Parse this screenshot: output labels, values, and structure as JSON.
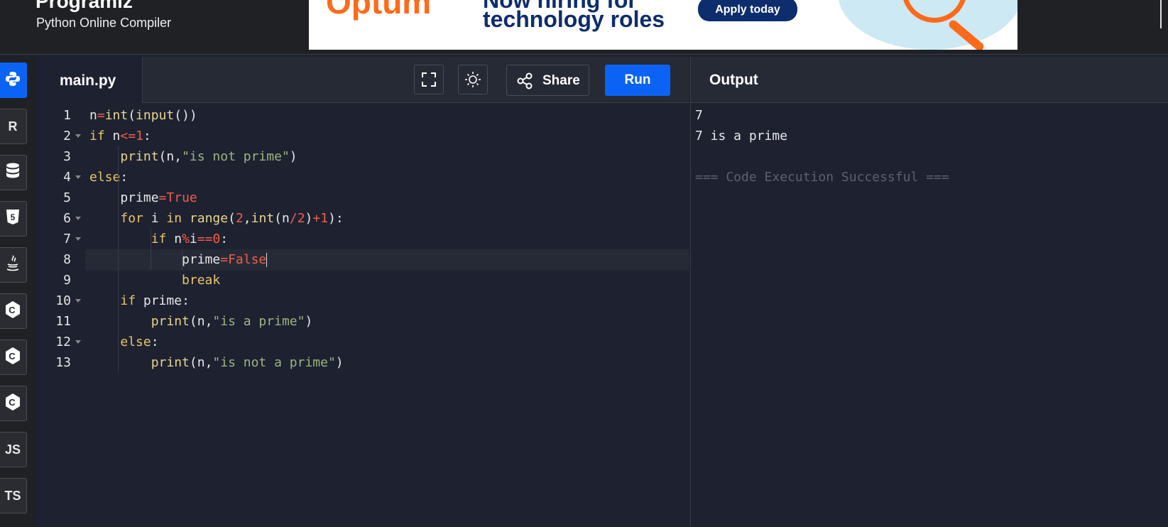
{
  "header": {
    "brand": "Programiz",
    "subtitle": "Python Online Compiler"
  },
  "ad": {
    "brand": "Optum",
    "headline_1": "Now hiring for",
    "headline_2": "technology roles",
    "button": "Apply today"
  },
  "languages": [
    {
      "name": "python-icon",
      "label": "",
      "active": true
    },
    {
      "name": "r-icon",
      "label": "R"
    },
    {
      "name": "sql-icon",
      "label": ""
    },
    {
      "name": "html5-icon",
      "label": "5"
    },
    {
      "name": "java-icon",
      "label": ""
    },
    {
      "name": "c-icon",
      "label": "C"
    },
    {
      "name": "cpp-icon",
      "label": "C"
    },
    {
      "name": "csharp-icon",
      "label": "C"
    },
    {
      "name": "js-icon",
      "label": "JS"
    },
    {
      "name": "ts-icon",
      "label": "TS"
    }
  ],
  "editor": {
    "file_tab": "main.py",
    "share_label": "Share",
    "run_label": "Run",
    "current_line": 8,
    "lines": [
      {
        "n": "1",
        "tokens": [
          [
            "",
            "n"
          ],
          [
            "op",
            "="
          ],
          [
            "fn",
            "int"
          ],
          [
            "",
            "("
          ],
          [
            "fn",
            "input"
          ],
          [
            "",
            "())"
          ]
        ]
      },
      {
        "n": "2",
        "fold": true,
        "tokens": [
          [
            "kw",
            "if"
          ],
          [
            "",
            " n"
          ],
          [
            "op",
            "<="
          ],
          [
            "num",
            "1"
          ],
          [
            "",
            ":"
          ]
        ]
      },
      {
        "n": "3",
        "tokens": [
          [
            "",
            "    "
          ],
          [
            "fn",
            "print"
          ],
          [
            "",
            "(n,"
          ],
          [
            "str",
            "\"is not prime\""
          ],
          [
            "",
            ")"
          ]
        ]
      },
      {
        "n": "4",
        "fold": true,
        "tokens": [
          [
            "kw",
            "else"
          ],
          [
            "",
            ":"
          ]
        ]
      },
      {
        "n": "5",
        "tokens": [
          [
            "",
            "    prime"
          ],
          [
            "op",
            "="
          ],
          [
            "num",
            "True"
          ]
        ]
      },
      {
        "n": "6",
        "fold": true,
        "tokens": [
          [
            "",
            "    "
          ],
          [
            "kw",
            "for"
          ],
          [
            "",
            " i "
          ],
          [
            "kw",
            "in"
          ],
          [
            "",
            " "
          ],
          [
            "fn",
            "range"
          ],
          [
            "",
            "("
          ],
          [
            "num",
            "2"
          ],
          [
            "",
            ","
          ],
          [
            "fn",
            "int"
          ],
          [
            "",
            "(n"
          ],
          [
            "op",
            "/"
          ],
          [
            "num",
            "2"
          ],
          [
            "",
            ")"
          ],
          [
            "op",
            "+"
          ],
          [
            "num",
            "1"
          ],
          [
            "",
            "):"
          ]
        ]
      },
      {
        "n": "7",
        "fold": true,
        "tokens": [
          [
            "",
            "        "
          ],
          [
            "kw",
            "if"
          ],
          [
            "",
            " n"
          ],
          [
            "op",
            "%"
          ],
          [
            "",
            "i"
          ],
          [
            "op",
            "=="
          ],
          [
            "num",
            "0"
          ],
          [
            "",
            ":"
          ]
        ]
      },
      {
        "n": "8",
        "tokens": [
          [
            "",
            "            prime"
          ],
          [
            "op",
            "="
          ],
          [
            "num",
            "False"
          ]
        ]
      },
      {
        "n": "9",
        "tokens": [
          [
            "",
            "            "
          ],
          [
            "kw",
            "break"
          ]
        ]
      },
      {
        "n": "10",
        "fold": true,
        "tokens": [
          [
            "",
            "    "
          ],
          [
            "kw",
            "if"
          ],
          [
            "",
            " prime:"
          ]
        ]
      },
      {
        "n": "11",
        "tokens": [
          [
            "",
            "        "
          ],
          [
            "fn",
            "print"
          ],
          [
            "",
            "(n,"
          ],
          [
            "str",
            "\"is a prime\""
          ],
          [
            "",
            ")"
          ]
        ]
      },
      {
        "n": "12",
        "fold": true,
        "tokens": [
          [
            "",
            "    "
          ],
          [
            "kw",
            "else"
          ],
          [
            "",
            ":"
          ]
        ]
      },
      {
        "n": "13",
        "tokens": [
          [
            "",
            "        "
          ],
          [
            "fn",
            "print"
          ],
          [
            "",
            "(n,"
          ],
          [
            "str",
            "\"is not a prime\""
          ],
          [
            "",
            ")"
          ]
        ]
      }
    ]
  },
  "output": {
    "title": "Output",
    "lines": [
      {
        "text": "7",
        "muted": false
      },
      {
        "text": "7 is a prime",
        "muted": false
      },
      {
        "text": "",
        "muted": false
      },
      {
        "text": "=== Code Execution Successful ===",
        "muted": true
      }
    ]
  },
  "colors": {
    "accent": "#0b63f6",
    "background": "#1d2130",
    "keyword": "#e9c46a",
    "number": "#f25d4b",
    "string": "#9fb37f"
  }
}
